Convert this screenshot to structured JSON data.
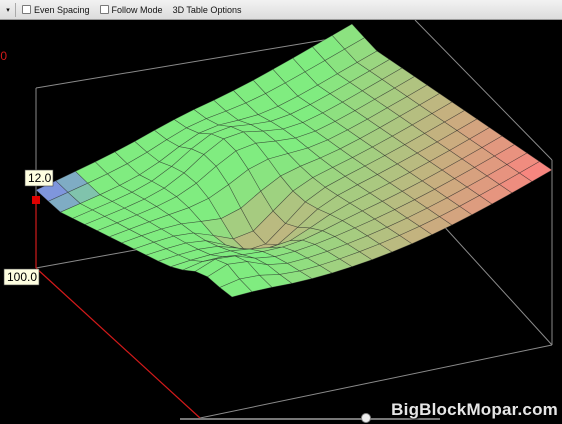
{
  "toolbar": {
    "dropdown_symbol": "▾",
    "even_spacing_label": "Even Spacing",
    "follow_mode_label": "Follow Mode",
    "table_options_label": "3D Table Options"
  },
  "plot": {
    "top_left_value": ".0",
    "marker_value": "12.0",
    "axis_value": "100.0",
    "colors": {
      "axis_red": "#d11a1a",
      "grid_gray": "#8a8a8a",
      "low": "#7f7ff5",
      "mid": "#80ec80",
      "high": "#ff7f7f"
    }
  },
  "watermark": "BigBlockMopar.com"
}
